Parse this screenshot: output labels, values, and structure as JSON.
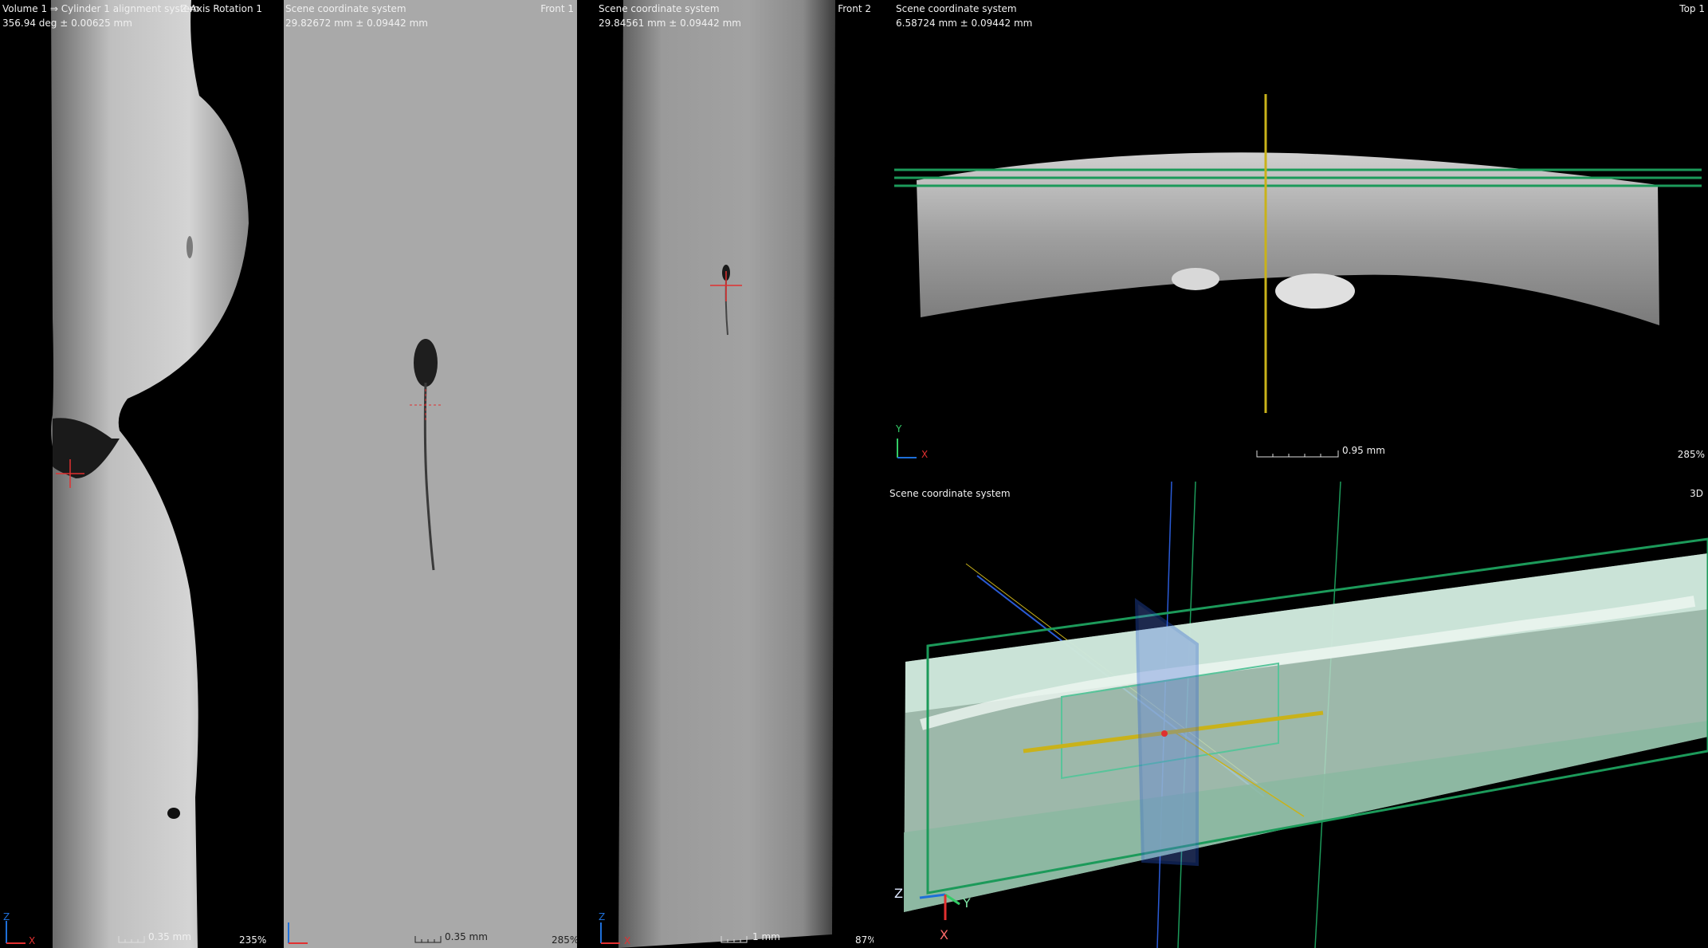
{
  "panels": {
    "z_rotation": {
      "title_left": "Volume 1 ⇒ Cylinder 1 alignment system",
      "title_right": "Z-Axis Rotation 1",
      "value": "356.94 deg ± 0.00625 mm",
      "scale": "0.35 mm",
      "zoom": "235%",
      "axis_v": "Z",
      "axis_h": "X"
    },
    "front1": {
      "title_left": "Scene coordinate system",
      "title_right": "Front 1",
      "value": "29.82672 mm ± 0.09442 mm",
      "scale": "0.35 mm",
      "zoom": "285%"
    },
    "front2": {
      "title_left": "Scene coordinate system",
      "title_right": "Front 2",
      "value": "29.84561 mm ± 0.09442 mm",
      "scale": "1 mm",
      "zoom": "87%",
      "axis_v": "Z",
      "axis_h": "X"
    },
    "top1": {
      "title_left": "Scene coordinate system",
      "title_right": "Top 1",
      "value": "6.58724 mm ± 0.09442 mm",
      "scale": "0.95 mm",
      "zoom": "285%",
      "axis_v": "Y",
      "axis_h": "X"
    },
    "view3d": {
      "title_left": "Scene coordinate system",
      "title_right": "3D",
      "axis_z": "Z",
      "axis_y": "Y",
      "axis_x": "X"
    }
  },
  "colors": {
    "axis_z": "#1e6fd9",
    "axis_x": "#e23030",
    "axis_y": "#33cc66",
    "plane_green": "#1c9a5a",
    "plane_blue": "#2a5bd6",
    "yellow_line": "#c9b21a",
    "crosshair": "#e03030"
  }
}
